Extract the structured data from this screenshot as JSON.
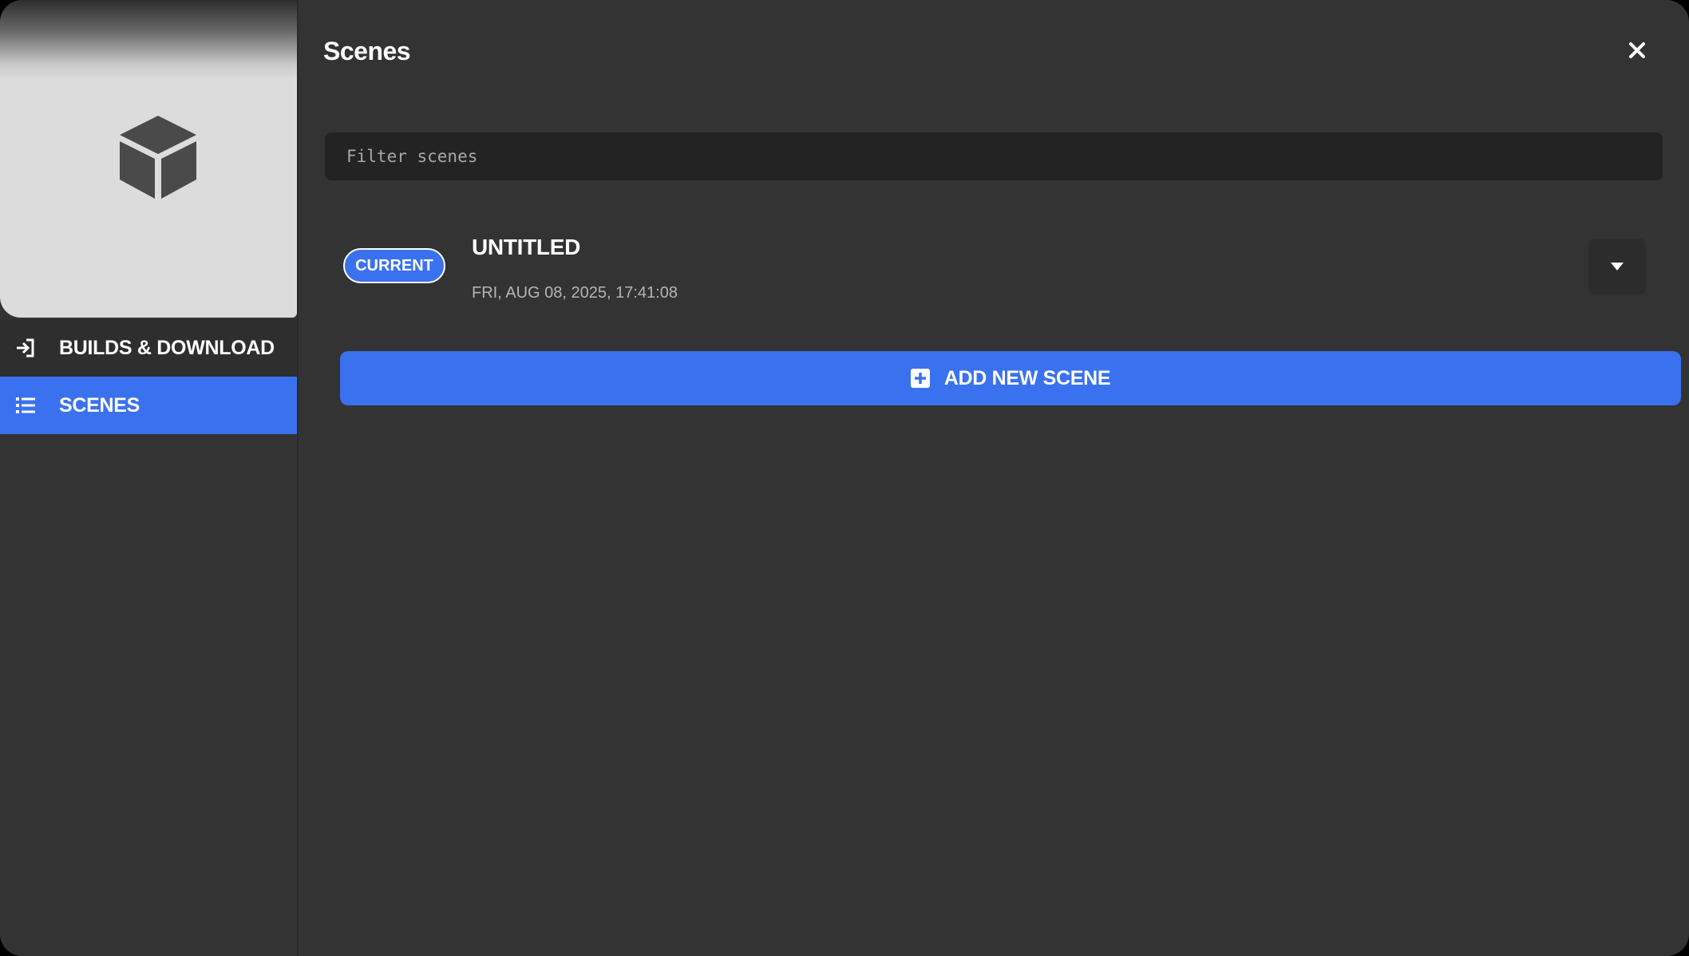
{
  "sidebar": {
    "preview_icon": "cube-icon",
    "items": [
      {
        "label": "BUILDS & DOWNLOAD",
        "icon": "sign-in-icon",
        "active": false
      },
      {
        "label": "SCENES",
        "icon": "list-icon",
        "active": true
      }
    ]
  },
  "main": {
    "title": "Scenes",
    "close_icon": "close-icon",
    "filter": {
      "placeholder": "Filter scenes",
      "value": ""
    },
    "scenes": [
      {
        "badge": "CURRENT",
        "name": "UNTITLED",
        "date": "FRI, AUG 08, 2025, 17:41:08",
        "menu_icon": "caret-down-icon"
      }
    ],
    "add_button": {
      "label": "ADD NEW SCENE",
      "icon": "plus-square-icon"
    }
  },
  "colors": {
    "background": "#333333",
    "accent": "#3a71ee",
    "input_bg": "#232323",
    "muted_text": "#b4b4b4"
  }
}
